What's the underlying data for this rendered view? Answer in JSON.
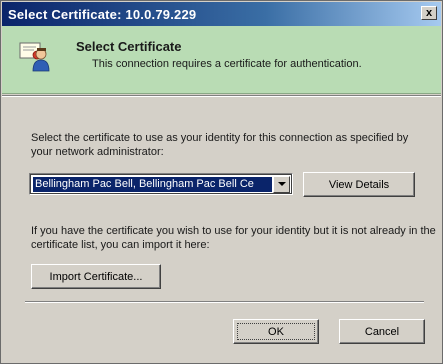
{
  "window": {
    "title": "Select Certificate: 10.0.79.229",
    "close_glyph": "x"
  },
  "header": {
    "title": "Select Certificate",
    "subtitle": "This connection requires a certificate for authentication.",
    "icon": "certificate-user-icon"
  },
  "body": {
    "instructions": "Select the certificate to use as your identity for this connection as specified by your network administrator:",
    "certificate_select": {
      "selected": "Bellingham Pac Bell, Bellingham Pac Bell Ce"
    },
    "view_details_label": "View Details",
    "import_text": "If you have the certificate you wish to use for your identity but it is not already in the certificate list, you can import it here:",
    "import_label": "Import Certificate..."
  },
  "footer": {
    "ok_label": "OK",
    "cancel_label": "Cancel"
  },
  "colors": {
    "titlebar_start": "#0a246a",
    "header_bg": "#b9dcb4",
    "dialog_bg": "#d4d0c8",
    "selection_bg": "#0a246a"
  }
}
